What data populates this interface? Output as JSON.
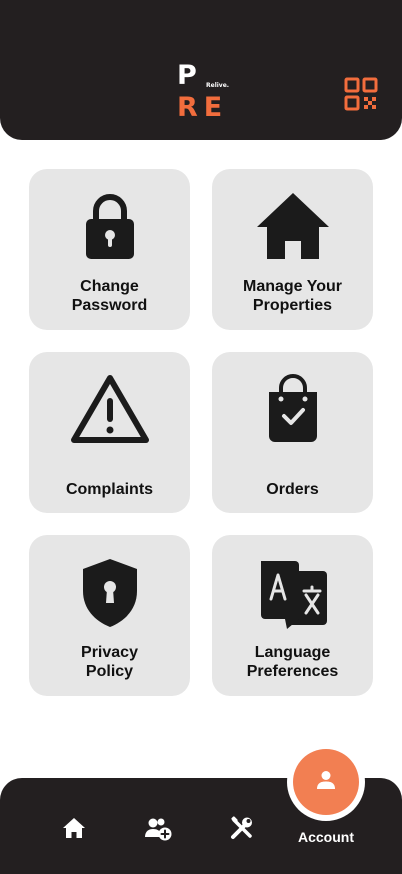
{
  "header": {
    "logo_letter_top": "P",
    "logo_tagline": "Relive.",
    "logo_letters_bottom": "RE",
    "qr_icon": "qr-code-icon"
  },
  "menu": {
    "items": [
      {
        "label": "Change\nPassword",
        "icon": "lock-icon"
      },
      {
        "label": "Manage Your\nProperties",
        "icon": "house-icon"
      },
      {
        "label": "Complaints",
        "icon": "warning-icon"
      },
      {
        "label": "Orders",
        "icon": "shopping-bag-check-icon"
      },
      {
        "label": "Privacy\nPolicy",
        "icon": "shield-keyhole-icon"
      },
      {
        "label": "Language\nPreferences",
        "icon": "translate-icon"
      }
    ]
  },
  "nav": {
    "items": [
      {
        "icon": "home-icon"
      },
      {
        "icon": "add-users-icon"
      },
      {
        "icon": "tools-icon"
      }
    ],
    "account_label": "Account",
    "account_icon": "user-icon"
  },
  "colors": {
    "dark": "#231f20",
    "accent": "#f26d3d",
    "card": "#e6e6e6"
  }
}
